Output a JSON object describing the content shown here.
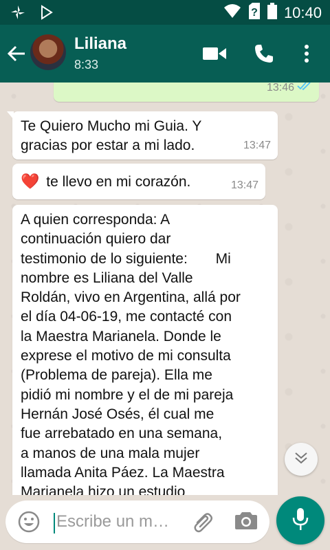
{
  "status_bar": {
    "time": "10:40",
    "icons": [
      "pinwheel-icon",
      "play-store-icon",
      "wifi-icon",
      "no-sim-icon",
      "battery-icon"
    ]
  },
  "header": {
    "contact_name": "Liliana",
    "subtitle": "8:33",
    "icons": [
      "back-arrow-icon",
      "video-call-icon",
      "voice-call-icon",
      "more-vert-icon"
    ]
  },
  "messages": [
    {
      "direction": "out",
      "text": "",
      "time": "13:46",
      "status": "read",
      "status_icon": "double-check-icon"
    },
    {
      "direction": "in",
      "text": "Te Quiero Mucho mi Guia. Y gracias por estar a mi lado.",
      "time": "13:47"
    },
    {
      "direction": "in",
      "emoji": "❤️",
      "text": "te llevo en mi corazón.",
      "time": "13:47"
    },
    {
      "direction": "in",
      "lines": [
        "A quien corresponda: A",
        "continuación quiero dar",
        "testimonio de lo siguiente:       Mi",
        "nombre es Liliana del Valle",
        "Roldán, vivo en Argentina, allá por",
        "el día 04-06-19, me contacté con",
        "la Maestra Marianela. Donde le",
        "exprese el motivo de mi consulta",
        "(Problema de pareja). Ella me",
        "pidió mi nombre y el de mi pareja",
        "Hernán José Osés, él cual me",
        "fue arrebatado en una semana,",
        "a manos de una mala mujer",
        "llamada Anita Páez. La Maestra",
        "Marianela hizo un estudio"
      ]
    }
  ],
  "composer": {
    "placeholder": "Escribe un m…",
    "value": "",
    "icons": [
      "emoji-icon",
      "attach-icon",
      "camera-icon",
      "mic-icon",
      "scroll-down-icon"
    ]
  },
  "colors": {
    "status_bar": "#054d44",
    "header": "#075e54",
    "accent": "#00897b",
    "chat_background": "#e5ddd5",
    "incoming_bubble": "#ffffff",
    "outgoing_bubble": "#dcf8c6",
    "read_ticks": "#4fc3f7"
  }
}
